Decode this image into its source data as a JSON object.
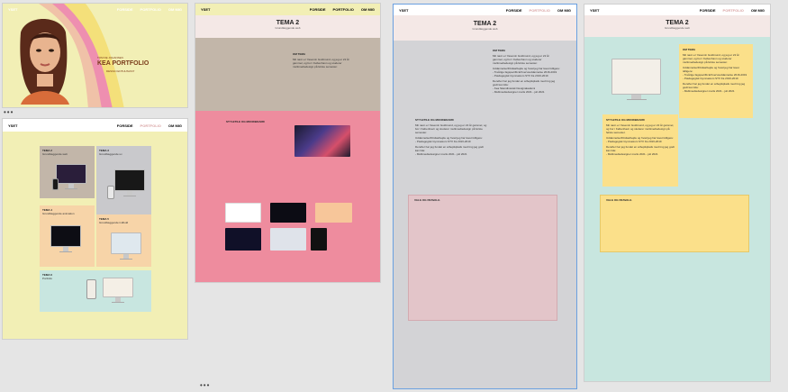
{
  "brand": "YSET",
  "nav": {
    "home": "FORSIDE",
    "portfolio": "PORTFOLIO",
    "about": "OM MIG"
  },
  "hero": {
    "tagline": "TOM DE JOHANSEN",
    "title": "KEA PORTFOLIO",
    "sub": "DESIGN ENTHUSIAST"
  },
  "portfolio_cards": [
    {
      "title": "TEMA 2",
      "sub": "Grundlæggende web"
    },
    {
      "title": "TEMA 3",
      "sub": "Grundlæggende ux"
    },
    {
      "title": "TEMA 4",
      "sub": "Grundlæggende animation"
    },
    {
      "title": "TEMA 5",
      "sub": "Grundlæggende indhold"
    },
    {
      "title": "TEMA 6",
      "sub": "Portfolio"
    }
  ],
  "tema": {
    "title": "TEMA 2",
    "sub": "Grundlæggende web",
    "om_tema_heading": "OM TEMA",
    "om_tema_p1": "Mit navn er Yasemin Guldmund, og jeg er 22 år gammel, og bor i København og studerer multimediedesign på første semester.",
    "om_tema_p2": "Uddannelse/fritidsarbejde og hvad jeg har lavet tidligere:",
    "om_tema_p3": "- Treårige fagspecifik Erhvervsuddannelse 2016-2019",
    "om_tema_p4": "- Pædagogisk Gymnasium STX fra 2016-2019",
    "om_tema_p5": "Derefter har jeg fundet en arbejdsplads med ting jeg godt kan lide:",
    "om_tema_p6": "- Kea Skandinavisk Designakademi",
    "om_tema_p7": "- Multimediedesigner marts 2021 - juli 2021",
    "stylebox_heading": "STYLETILE OG MOODBOARD",
    "valg_heading": "VALG OG FRAVALG"
  }
}
